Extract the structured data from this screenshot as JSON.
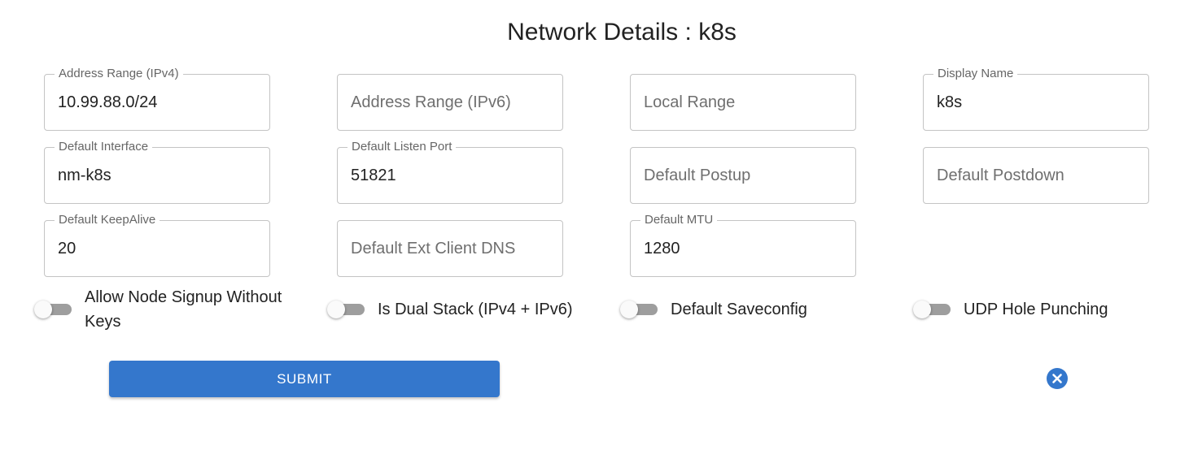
{
  "title": "Network Details : k8s",
  "fields": {
    "addressrange": {
      "label": "Address Range (IPv4)",
      "value": "10.99.88.0/24",
      "placeholder": ""
    },
    "addressrange6": {
      "label": "",
      "value": "",
      "placeholder": "Address Range (IPv6)"
    },
    "localrange": {
      "label": "",
      "value": "",
      "placeholder": "Local Range"
    },
    "displayname": {
      "label": "Display Name",
      "value": "k8s",
      "placeholder": ""
    },
    "defaultinterface": {
      "label": "Default Interface",
      "value": "nm-k8s",
      "placeholder": ""
    },
    "defaultlistenport": {
      "label": "Default Listen Port",
      "value": "51821",
      "placeholder": ""
    },
    "defaultpostup": {
      "label": "",
      "value": "",
      "placeholder": "Default Postup"
    },
    "defaultpostdown": {
      "label": "",
      "value": "",
      "placeholder": "Default Postdown"
    },
    "defaultkeepalive": {
      "label": "Default KeepAlive",
      "value": "20",
      "placeholder": ""
    },
    "defaultextclientdns": {
      "label": "",
      "value": "",
      "placeholder": "Default Ext Client DNS"
    },
    "defaultmtu": {
      "label": "Default MTU",
      "value": "1280",
      "placeholder": ""
    }
  },
  "switches": {
    "allownodesignup": {
      "label": "Allow Node Signup Without Keys",
      "checked": false
    },
    "isdualstack": {
      "label": "Is Dual Stack (IPv4 + IPv6)",
      "checked": false
    },
    "defaultsaveconfig": {
      "label": "Default Saveconfig",
      "checked": false
    },
    "udpholepunching": {
      "label": "UDP Hole Punching",
      "checked": false
    }
  },
  "actions": {
    "submit_label": "SUBMIT",
    "cancel_icon": "close-circle-icon"
  },
  "colors": {
    "primary": "#3477cc",
    "switch_track_off": "#9e9e9e",
    "field_border": "#c4c4c4"
  }
}
